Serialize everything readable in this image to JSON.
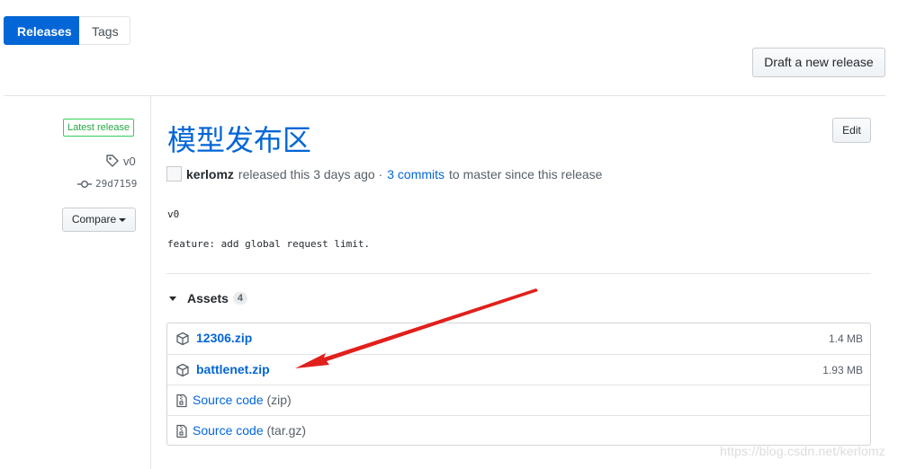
{
  "tabs": {
    "releases": "Releases",
    "tags": "Tags"
  },
  "actions": {
    "draft_release": "Draft a new release",
    "edit": "Edit",
    "compare": "Compare"
  },
  "sidebar": {
    "latest_badge": "Latest release",
    "tag": "v0",
    "commit": "29d7159"
  },
  "release": {
    "title": "模型发布区",
    "author": "kerlomz",
    "released_text": "released this 3 days ago ·",
    "commits_link": "3 commits",
    "commits_suffix": "to master since this release",
    "body_line1": "v0",
    "body_line2": "feature: add global request limit."
  },
  "assets": {
    "label": "Assets",
    "count": "4",
    "items": [
      {
        "name": "12306.zip",
        "size": "1.4 MB",
        "icon": "package-icon"
      },
      {
        "name": "battlenet.zip",
        "size": "1.93 MB",
        "icon": "package-icon"
      },
      {
        "name": "Source code",
        "suffix": "(zip)",
        "icon": "file-zip-icon"
      },
      {
        "name": "Source code",
        "suffix": "(tar.gz)",
        "icon": "file-zip-icon"
      }
    ]
  },
  "annotation": {
    "arrow_color": "#e0201c"
  },
  "watermark": "https://blog.csdn.net/kerlomz",
  "colors": {
    "accent": "#0366d6",
    "success": "#28a745"
  }
}
